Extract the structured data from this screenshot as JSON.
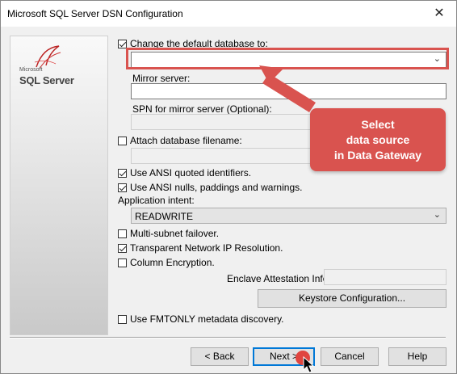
{
  "window": {
    "title": "Microsoft SQL Server DSN Configuration",
    "close_glyph": "✕"
  },
  "logo": {
    "brand_small": "Microsoft",
    "brand_name": "SQL Server"
  },
  "form": {
    "change_default_db": {
      "label": "Change the default database to:",
      "checked": true,
      "value": ""
    },
    "mirror_server": {
      "label": "Mirror server:",
      "value": ""
    },
    "spn_mirror": {
      "label": "SPN for mirror server (Optional):",
      "value": ""
    },
    "attach_db_filename": {
      "label": "Attach database filename:",
      "checked": false,
      "value": ""
    },
    "ansi_quoted": {
      "label": "Use ANSI quoted identifiers.",
      "checked": true
    },
    "ansi_nulls": {
      "label": "Use ANSI nulls, paddings and warnings.",
      "checked": true
    },
    "application_intent": {
      "label": "Application intent:",
      "value": "READWRITE"
    },
    "multi_subnet": {
      "label": "Multi-subnet failover.",
      "checked": false
    },
    "transparent_ip": {
      "label": "Transparent Network IP Resolution.",
      "checked": true
    },
    "column_encryption": {
      "label": "Column Encryption.",
      "checked": false
    },
    "enclave_info": {
      "label": "Enclave Attestation Info:",
      "value": ""
    },
    "keystore_button": "Keystore Configuration...",
    "fmtonly": {
      "label": "Use FMTONLY metadata discovery.",
      "checked": false
    }
  },
  "buttons": {
    "back": "< Back",
    "next": "Next >",
    "cancel": "Cancel",
    "help": "Help"
  },
  "annotation": {
    "callout_lines": [
      "Select",
      "data source",
      "in Data Gateway"
    ],
    "accent_color": "#d9534f"
  }
}
